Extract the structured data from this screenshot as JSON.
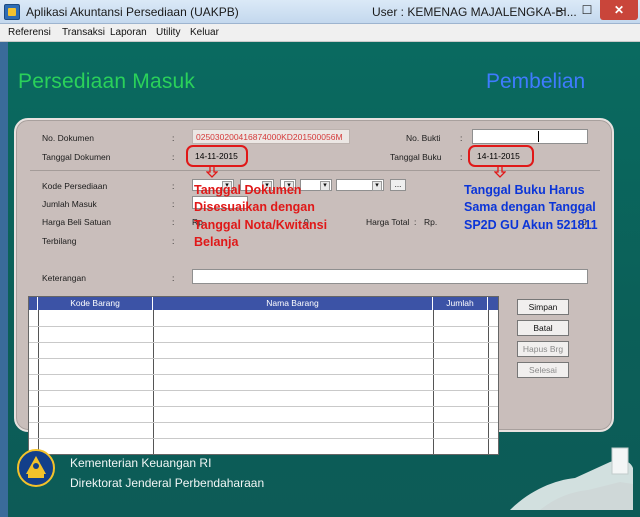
{
  "window": {
    "title": "Aplikasi Akuntansi Persediaan (UAKPB)",
    "user": "User : KEMENAG MAJALENGKA-BI...",
    "minimize": "─",
    "maximize": "☐",
    "close": "✕"
  },
  "menu": [
    "Referensi",
    "Transaksi",
    "Laporan",
    "Utility",
    "Keluar"
  ],
  "header": {
    "left": "Persediaan Masuk",
    "right": "Pembelian"
  },
  "form": {
    "no_dokumen_label": "No. Dokumen",
    "no_dokumen_value": "025030200416874000KD201500056M",
    "no_bukti_label": "No. Bukti",
    "no_bukti_value": "",
    "tanggal_dokumen_label": "Tanggal Dokumen",
    "tanggal_dokumen_value": "14-11-2015",
    "tanggal_buku_label": "Tanggal Buku",
    "tanggal_buku_value": "14-11-2015",
    "kode_persediaan_label": "Kode Persediaan",
    "jumlah_masuk_label": "Jumlah Masuk",
    "harga_beli_label": "Harga Beli Satuan",
    "harga_beli_prefix": "Rp.",
    "harga_total_label": "Harga Total",
    "harga_total_prefix": "Rp.",
    "harga_total_value": "0",
    "harga_beli_value": "0",
    "terbilang_label": "Terbilang",
    "keterangan_label": "Keterangan",
    "keterangan_value": "",
    "colon": ":",
    "ellipsis": "..."
  },
  "annotations": {
    "left_line1": "Tanggal Dokumen",
    "left_line2": "Disesuaikan dengan",
    "left_line3": "Tanggal Nota/Kwitansi",
    "left_line4": "Belanja",
    "right_line1": "Tanggal Buku Harus",
    "right_line2": "Sama dengan Tanggal",
    "right_line3": "SP2D GU Akun 521811"
  },
  "table": {
    "columns": [
      "Kode Barang",
      "Nama Barang",
      "Jumlah"
    ]
  },
  "buttons": {
    "simpan": "Simpan",
    "batal": "Batal",
    "hapus": "Hapus Brg",
    "selesai": "Selesai"
  },
  "footer": {
    "line1": "Kementerian Keuangan RI",
    "line2": "Direktorat Jenderal Perbendaharaan"
  },
  "colors": {
    "background": "#0b5f58",
    "heading_green": "#2ad15a",
    "heading_blue": "#3f7bff",
    "annotation_red": "#e01818",
    "annotation_blue": "#0b35d8",
    "grid_header": "#3c53a6"
  }
}
